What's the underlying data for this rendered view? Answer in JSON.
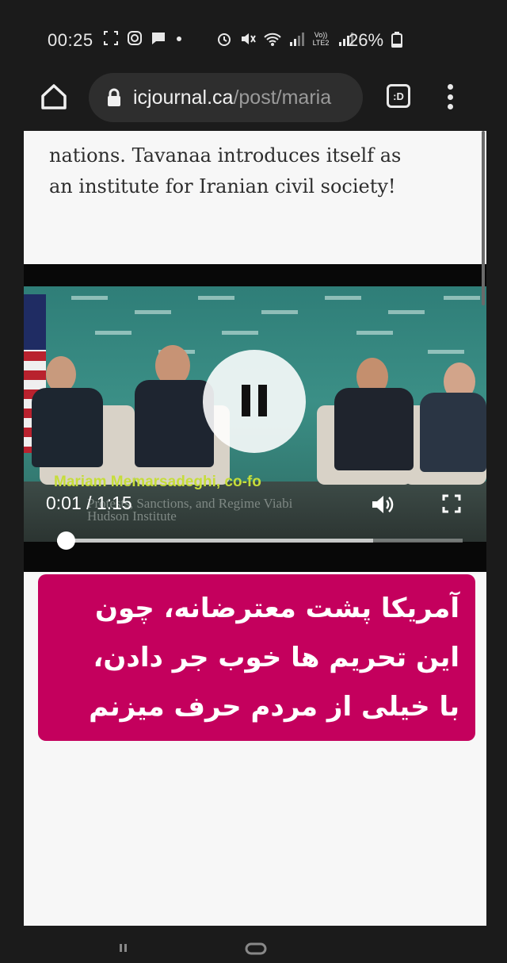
{
  "status_bar": {
    "time": "00:25",
    "network": "Vo)) LTE2",
    "battery": "26%"
  },
  "browser": {
    "url_domain": "icjournal.ca",
    "url_path": "/post/maria",
    "tab_label": ":D"
  },
  "article": {
    "text_line_1": "nations. Tavanaa introduces itself as",
    "text_line_2": "an institute for Iranian civil society!"
  },
  "video": {
    "lower_third": "Mariam Memarsadeghi, co-fo",
    "lower_third_sub": "Protests, Sanctions, and Regime Viabi",
    "lower_third_org": "Hudson Institute",
    "current_time": "0:01",
    "duration": "1:15",
    "time_display": "0:01 / 1:15",
    "progress": 0.01,
    "buffered": 0.78
  },
  "caption": {
    "line_1": "آمریکا پشت معترضانه، چون",
    "line_2": "این تحریم ها خوب جر دادن،",
    "line_3": "با خیلی از مردم حرف میزنم",
    "background": "#c4005d"
  },
  "colors": {
    "lower_third_text": "#c6dd3a",
    "page_background": "#f7f7f7",
    "system_background": "#1b1b1b"
  }
}
